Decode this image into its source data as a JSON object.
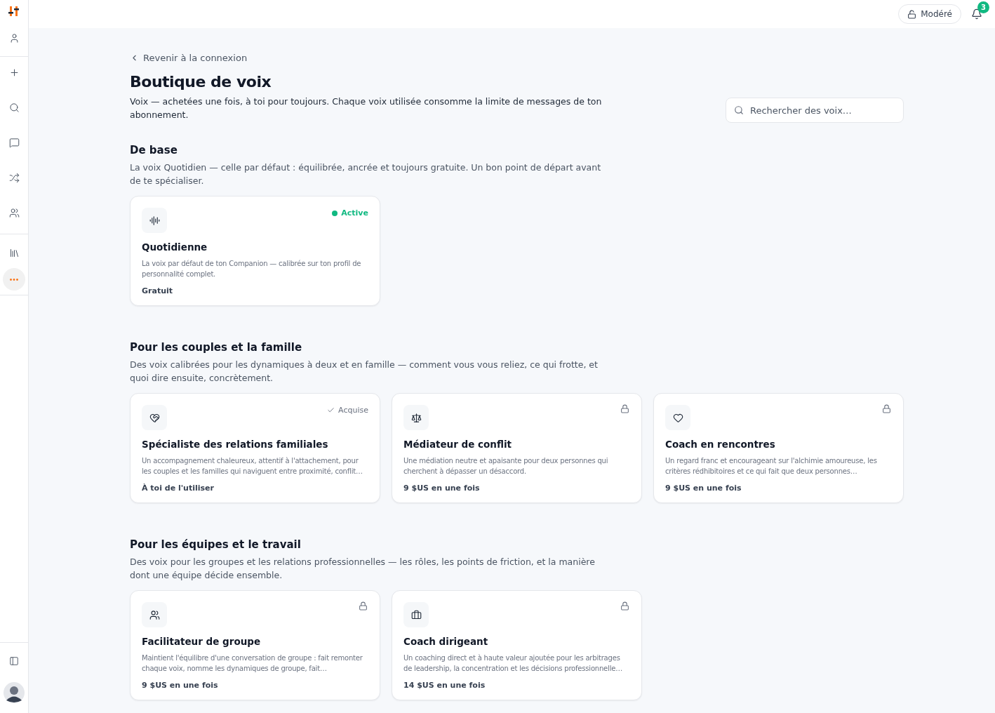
{
  "sidebar": {
    "items": [
      {
        "kind": "profile",
        "selected": false
      },
      {
        "kind": "new",
        "selected": false
      },
      {
        "kind": "search",
        "selected": false
      },
      {
        "kind": "chat",
        "selected": false
      },
      {
        "kind": "tools",
        "selected": false
      },
      {
        "kind": "people",
        "selected": false
      },
      {
        "kind": "library",
        "selected": false
      },
      {
        "kind": "more",
        "selected": true
      }
    ]
  },
  "topbar": {
    "mode_button": "Modéré",
    "notifications": "3"
  },
  "back_link": "Revenir à la connexion",
  "title": "Boutique de voix",
  "subtitle": "Voix — achetées une fois, à toi pour toujours. Chaque voix utilisée consomme la limite de messages de ton abonnement.",
  "search": {
    "placeholder": "Rechercher des voix…"
  },
  "sections": [
    {
      "title": "De base",
      "description": "La voix Quotidien — celle par défaut : équilibrée, ancrée et toujours gratuite. Un bon point de départ avant de te spécialiser.",
      "cards": [
        {
          "name": "Quotidienne",
          "description": "La voix par défaut de ton Companion — calibrée sur ton profil de personnalité complet.",
          "price": "Gratuit",
          "kind": "active",
          "status_label": "Active"
        }
      ]
    },
    {
      "title": "Pour les couples et la famille",
      "description": "Des voix calibrées pour les dynamiques à deux et en famille — comment vous vous reliez, ce qui frotte, et quoi dire ensuite, concrètement.",
      "cards": [
        {
          "name": "Spécialiste des relations familiales",
          "description": "Un accompagnement chaleureux, attentif à l'attachement, pour les couples et les familles qui naviguent entre proximité, conflit…",
          "price": "À toi de l'utiliser",
          "kind": "owned",
          "status_label": "Acquise"
        },
        {
          "name": "Médiateur de conflit",
          "description": "Une médiation neutre et apaisante pour deux personnes qui cherchent à dépasser un désaccord.",
          "price": "9 $US en une fois",
          "kind": "locked"
        },
        {
          "name": "Coach en rencontres",
          "description": "Un regard franc et encourageant sur l'alchimie amoureuse, les critères rédhibitoires et ce qui fait que deux personnes…",
          "price": "9 $US en une fois",
          "kind": "locked"
        }
      ]
    },
    {
      "title": "Pour les équipes et le travail",
      "description": "Des voix pour les groupes et les relations professionnelles — les rôles, les points de friction, et la manière dont une équipe décide ensemble.",
      "cards": [
        {
          "name": "Facilitateur de groupe",
          "description": "Maintient l'équilibre d'une conversation de groupe : fait remonter chaque voix, nomme les dynamiques de groupe, fait…",
          "price": "9 $US en une fois",
          "kind": "locked"
        },
        {
          "name": "Coach dirigeant",
          "description": "Un coaching direct et à haute valeur ajoutée pour les arbitrages de leadership, la concentration et les décisions professionnelle…",
          "price": "14 $US en une fois",
          "kind": "locked"
        }
      ]
    }
  ]
}
